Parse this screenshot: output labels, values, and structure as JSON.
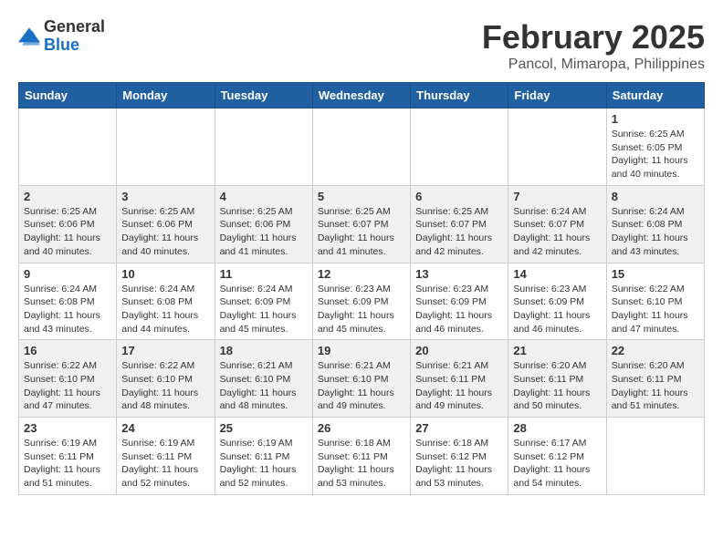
{
  "header": {
    "logo_general": "General",
    "logo_blue": "Blue",
    "title": "February 2025",
    "subtitle": "Pancol, Mimaropa, Philippines"
  },
  "calendar": {
    "days_of_week": [
      "Sunday",
      "Monday",
      "Tuesday",
      "Wednesday",
      "Thursday",
      "Friday",
      "Saturday"
    ],
    "weeks": [
      {
        "cells": [
          {
            "day": "",
            "info": ""
          },
          {
            "day": "",
            "info": ""
          },
          {
            "day": "",
            "info": ""
          },
          {
            "day": "",
            "info": ""
          },
          {
            "day": "",
            "info": ""
          },
          {
            "day": "",
            "info": ""
          },
          {
            "day": "1",
            "info": "Sunrise: 6:25 AM\nSunset: 6:05 PM\nDaylight: 11 hours and 40 minutes."
          }
        ]
      },
      {
        "cells": [
          {
            "day": "2",
            "info": "Sunrise: 6:25 AM\nSunset: 6:06 PM\nDaylight: 11 hours and 40 minutes."
          },
          {
            "day": "3",
            "info": "Sunrise: 6:25 AM\nSunset: 6:06 PM\nDaylight: 11 hours and 40 minutes."
          },
          {
            "day": "4",
            "info": "Sunrise: 6:25 AM\nSunset: 6:06 PM\nDaylight: 11 hours and 41 minutes."
          },
          {
            "day": "5",
            "info": "Sunrise: 6:25 AM\nSunset: 6:07 PM\nDaylight: 11 hours and 41 minutes."
          },
          {
            "day": "6",
            "info": "Sunrise: 6:25 AM\nSunset: 6:07 PM\nDaylight: 11 hours and 42 minutes."
          },
          {
            "day": "7",
            "info": "Sunrise: 6:24 AM\nSunset: 6:07 PM\nDaylight: 11 hours and 42 minutes."
          },
          {
            "day": "8",
            "info": "Sunrise: 6:24 AM\nSunset: 6:08 PM\nDaylight: 11 hours and 43 minutes."
          }
        ]
      },
      {
        "cells": [
          {
            "day": "9",
            "info": "Sunrise: 6:24 AM\nSunset: 6:08 PM\nDaylight: 11 hours and 43 minutes."
          },
          {
            "day": "10",
            "info": "Sunrise: 6:24 AM\nSunset: 6:08 PM\nDaylight: 11 hours and 44 minutes."
          },
          {
            "day": "11",
            "info": "Sunrise: 6:24 AM\nSunset: 6:09 PM\nDaylight: 11 hours and 45 minutes."
          },
          {
            "day": "12",
            "info": "Sunrise: 6:23 AM\nSunset: 6:09 PM\nDaylight: 11 hours and 45 minutes."
          },
          {
            "day": "13",
            "info": "Sunrise: 6:23 AM\nSunset: 6:09 PM\nDaylight: 11 hours and 46 minutes."
          },
          {
            "day": "14",
            "info": "Sunrise: 6:23 AM\nSunset: 6:09 PM\nDaylight: 11 hours and 46 minutes."
          },
          {
            "day": "15",
            "info": "Sunrise: 6:22 AM\nSunset: 6:10 PM\nDaylight: 11 hours and 47 minutes."
          }
        ]
      },
      {
        "cells": [
          {
            "day": "16",
            "info": "Sunrise: 6:22 AM\nSunset: 6:10 PM\nDaylight: 11 hours and 47 minutes."
          },
          {
            "day": "17",
            "info": "Sunrise: 6:22 AM\nSunset: 6:10 PM\nDaylight: 11 hours and 48 minutes."
          },
          {
            "day": "18",
            "info": "Sunrise: 6:21 AM\nSunset: 6:10 PM\nDaylight: 11 hours and 48 minutes."
          },
          {
            "day": "19",
            "info": "Sunrise: 6:21 AM\nSunset: 6:10 PM\nDaylight: 11 hours and 49 minutes."
          },
          {
            "day": "20",
            "info": "Sunrise: 6:21 AM\nSunset: 6:11 PM\nDaylight: 11 hours and 49 minutes."
          },
          {
            "day": "21",
            "info": "Sunrise: 6:20 AM\nSunset: 6:11 PM\nDaylight: 11 hours and 50 minutes."
          },
          {
            "day": "22",
            "info": "Sunrise: 6:20 AM\nSunset: 6:11 PM\nDaylight: 11 hours and 51 minutes."
          }
        ]
      },
      {
        "cells": [
          {
            "day": "23",
            "info": "Sunrise: 6:19 AM\nSunset: 6:11 PM\nDaylight: 11 hours and 51 minutes."
          },
          {
            "day": "24",
            "info": "Sunrise: 6:19 AM\nSunset: 6:11 PM\nDaylight: 11 hours and 52 minutes."
          },
          {
            "day": "25",
            "info": "Sunrise: 6:19 AM\nSunset: 6:11 PM\nDaylight: 11 hours and 52 minutes."
          },
          {
            "day": "26",
            "info": "Sunrise: 6:18 AM\nSunset: 6:11 PM\nDaylight: 11 hours and 53 minutes."
          },
          {
            "day": "27",
            "info": "Sunrise: 6:18 AM\nSunset: 6:12 PM\nDaylight: 11 hours and 53 minutes."
          },
          {
            "day": "28",
            "info": "Sunrise: 6:17 AM\nSunset: 6:12 PM\nDaylight: 11 hours and 54 minutes."
          },
          {
            "day": "",
            "info": ""
          }
        ]
      }
    ]
  }
}
